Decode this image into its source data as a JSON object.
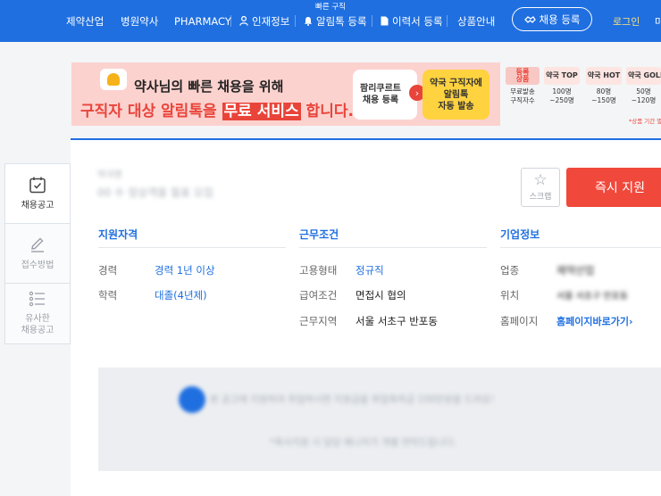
{
  "nav": {
    "items": [
      "제약산업",
      "병원약사",
      "PHARMACY",
      "인재정보",
      "알림톡 등록",
      "이력서 등록",
      "상품안내"
    ],
    "badge": "빠른 구직",
    "cta": "채용 등록",
    "login": "로그인",
    "more": "마"
  },
  "banner": {
    "line1": "약사님의 빠른 채용을 위해",
    "line2_pre": "구직자 대상 알림톡을 ",
    "line2_highlight": "무료 서비스",
    "line2_post": " 합니다.",
    "card": "팜리쿠르트\n채용 등록",
    "arrow": "›",
    "yellow": "약국 구직자에\n알림톡\n자동 발송",
    "accent": "#e9443a"
  },
  "price": {
    "head_label": "등록\n상품",
    "row_label": "무료발송\n구직자수",
    "cols": [
      {
        "name": "약국 TOP",
        "value": "100명\n~250명"
      },
      {
        "name": "약국 HOT",
        "value": "80명\n~150명"
      },
      {
        "name": "약국 GOLD",
        "value": "50명\n~120명"
      }
    ],
    "note": "*상품 기간 별"
  },
  "side": {
    "tabs": [
      "채용공고",
      "접수방법",
      "유사한\n채용공고"
    ]
  },
  "job": {
    "company": "약국명",
    "title": "00 수 정상객을 월표 모집",
    "scrap": "스크랩",
    "apply": "즉시 지원"
  },
  "sections": {
    "qualification": {
      "title": "지원자격",
      "rows": [
        {
          "label": "경력",
          "value": "경력 1년 이상"
        },
        {
          "label": "학력",
          "value": "대졸(4년제)"
        }
      ]
    },
    "conditions": {
      "title": "근무조건",
      "rows": [
        {
          "label": "고용형태",
          "value": "정규직"
        },
        {
          "label": "급여조건",
          "value": "면접시 협의"
        },
        {
          "label": "근무지역",
          "value": "서울 서초구 반포동"
        }
      ]
    },
    "company": {
      "title": "기업정보",
      "rows": [
        {
          "label": "업종",
          "value": "제약산업"
        },
        {
          "label": "위치",
          "value": "서울 서초구 반포동"
        },
        {
          "label": "홈페이지",
          "value": "홈페이지바로가기"
        }
      ],
      "link_arrow": "›"
    }
  },
  "notice": {
    "text1": "본 공고에 지원하여 취업하시면 지원금을 취업축하금 100만원을 드려요!",
    "text2": "*축사지원 시 담당 매니저가 개별 연락드립니다."
  },
  "colors": {
    "brand": "#1f6fe0",
    "apply": "#f0493c"
  }
}
